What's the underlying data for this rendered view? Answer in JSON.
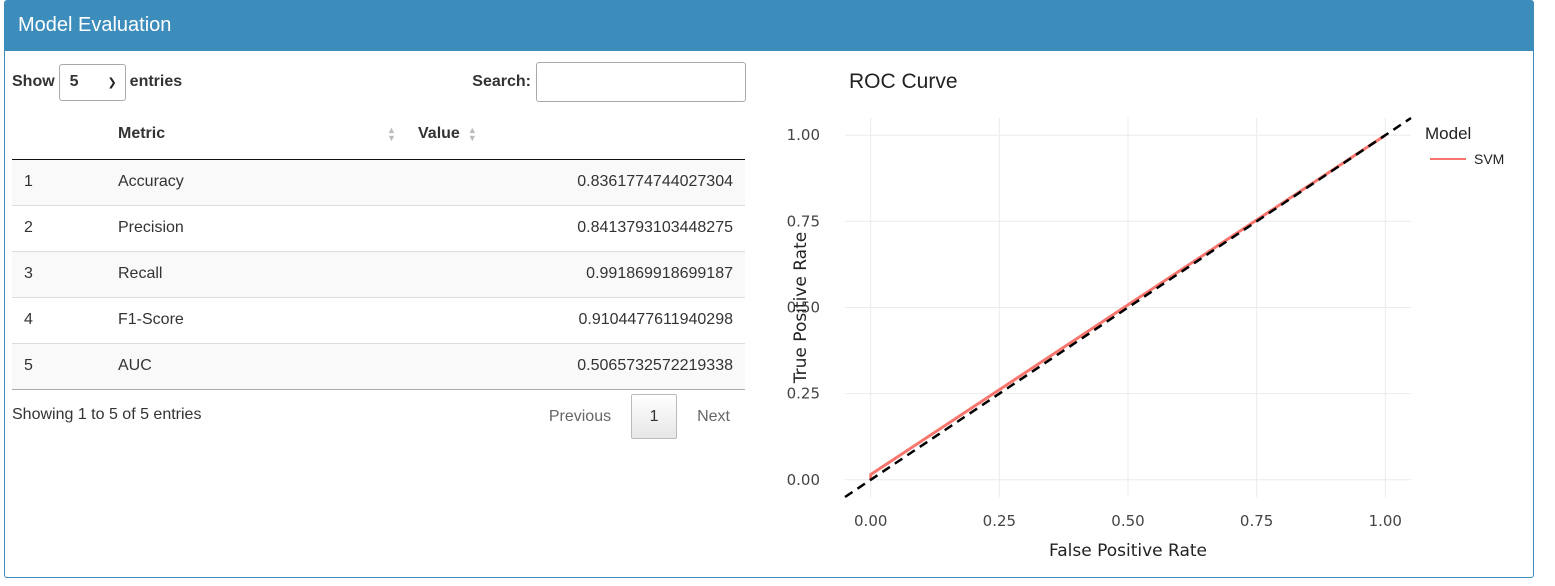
{
  "panel": {
    "title": "Model Evaluation"
  },
  "table_controls": {
    "show_label": "Show",
    "entries_value": "5",
    "entries_label": "entries",
    "search_label": "Search:",
    "search_value": ""
  },
  "table": {
    "columns": [
      "",
      "Metric",
      "Value"
    ],
    "rows": [
      {
        "index": "1",
        "metric": "Accuracy",
        "value": "0.8361774744027304"
      },
      {
        "index": "2",
        "metric": "Precision",
        "value": "0.8413793103448275"
      },
      {
        "index": "3",
        "metric": "Recall",
        "value": "0.991869918699187"
      },
      {
        "index": "4",
        "metric": "F1-Score",
        "value": "0.9104477611940298"
      },
      {
        "index": "5",
        "metric": "AUC",
        "value": "0.5065732572219338"
      }
    ]
  },
  "table_footer": {
    "info": "Showing 1 to 5 of 5 entries",
    "previous": "Previous",
    "current_page": "1",
    "next": "Next"
  },
  "colors": {
    "header_bg": "#3c8dbc",
    "svm_line": "#f8766d",
    "diagonal": "#000000"
  },
  "chart_data": {
    "type": "line",
    "title": "ROC Curve",
    "xlabel": "False Positive Rate",
    "ylabel": "True Positive Rate",
    "xlim": [
      -0.05,
      1.05
    ],
    "ylim": [
      -0.05,
      1.05
    ],
    "xticks": [
      "0.00",
      "0.25",
      "0.50",
      "0.75",
      "1.00"
    ],
    "yticks": [
      "0.00",
      "0.25",
      "0.50",
      "0.75",
      "1.00"
    ],
    "grid": true,
    "legend_title": "Model",
    "legend_placement": "right",
    "series": [
      {
        "name": "SVM",
        "x": [
          0.0,
          0.0,
          0.01,
          1.0
        ],
        "y": [
          0.0,
          0.015,
          0.025,
          1.0
        ]
      }
    ],
    "reference_line": {
      "style": "dashed",
      "x": [
        -0.05,
        1.05
      ],
      "y": [
        -0.05,
        1.05
      ]
    }
  }
}
